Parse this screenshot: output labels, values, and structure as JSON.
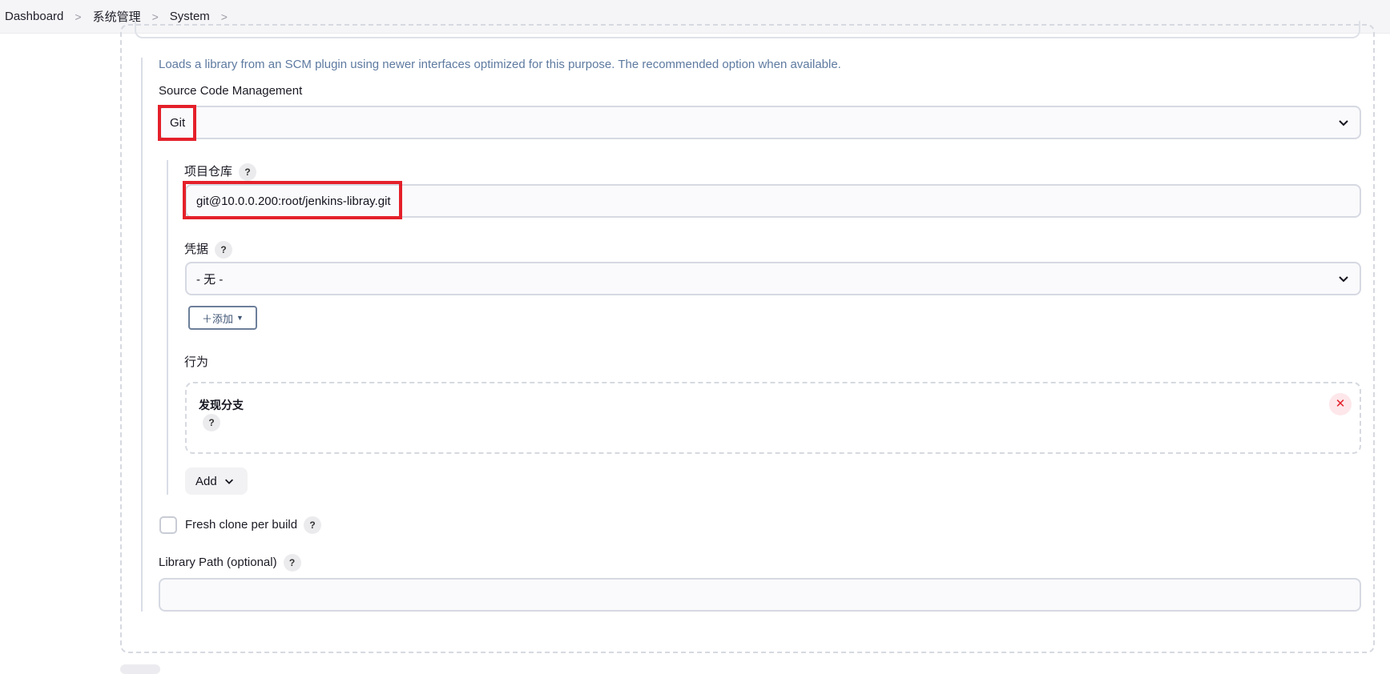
{
  "breadcrumb": {
    "items": [
      "Dashboard",
      "系统管理",
      "System"
    ]
  },
  "scm": {
    "description": "Loads a library from an SCM plugin using newer interfaces optimized for this purpose. The recommended option when available.",
    "label": "Source Code Management",
    "selected": "Git"
  },
  "git": {
    "repo_label": "项目仓库",
    "repo_value": "git@10.0.0.200:root/jenkins-libray.git",
    "credentials_label": "凭据",
    "credentials_selected": "- 无 -",
    "add_credentials_label": "＋添加",
    "behaviors_label": "行为",
    "behavior_item": "发现分支",
    "add_label": "Add"
  },
  "fresh_clone": {
    "label": "Fresh clone per build",
    "checked": false
  },
  "library_path": {
    "label": "Library Path (optional)",
    "value": ""
  },
  "help_glyph": "?",
  "close_glyph": "✕",
  "colors": {
    "highlight": "#e4202a",
    "description": "#5e7aa0"
  }
}
